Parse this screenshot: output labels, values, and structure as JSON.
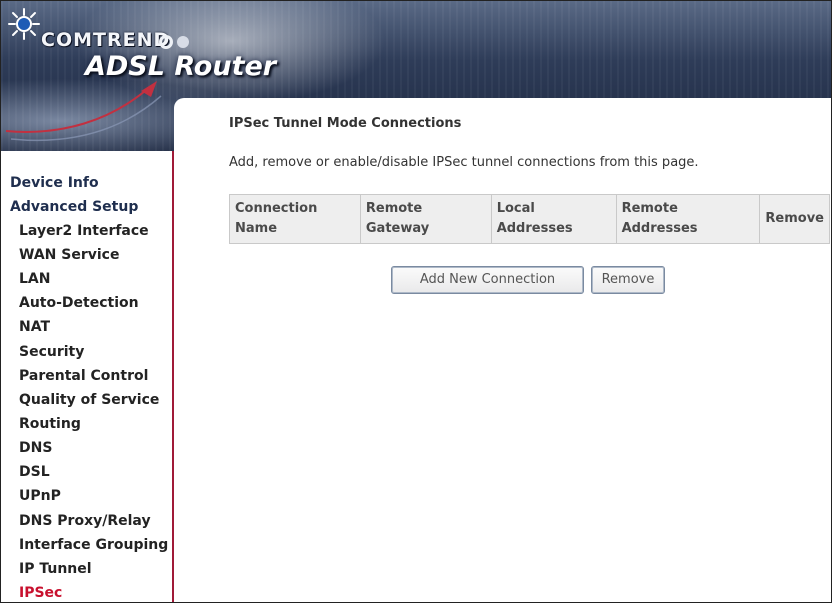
{
  "header": {
    "brand": "COMTREND",
    "product": "ADSL Router"
  },
  "sidebar": {
    "items": [
      {
        "label": "Device Info",
        "level": 0,
        "active": false
      },
      {
        "label": "Advanced Setup",
        "level": 0,
        "active": false
      },
      {
        "label": "Layer2 Interface",
        "level": 1,
        "active": false
      },
      {
        "label": "WAN Service",
        "level": 1,
        "active": false
      },
      {
        "label": "LAN",
        "level": 1,
        "active": false
      },
      {
        "label": "Auto-Detection",
        "level": 1,
        "active": false
      },
      {
        "label": "NAT",
        "level": 1,
        "active": false
      },
      {
        "label": "Security",
        "level": 1,
        "active": false
      },
      {
        "label": "Parental Control",
        "level": 1,
        "active": false
      },
      {
        "label": "Quality of Service",
        "level": 1,
        "active": false
      },
      {
        "label": "Routing",
        "level": 1,
        "active": false
      },
      {
        "label": "DNS",
        "level": 1,
        "active": false
      },
      {
        "label": "DSL",
        "level": 1,
        "active": false
      },
      {
        "label": "UPnP",
        "level": 1,
        "active": false
      },
      {
        "label": "DNS Proxy/Relay",
        "level": 1,
        "active": false
      },
      {
        "label": "Interface Grouping",
        "level": 1,
        "active": false
      },
      {
        "label": "IP Tunnel",
        "level": 1,
        "active": false
      },
      {
        "label": "IPSec",
        "level": 1,
        "active": true
      }
    ]
  },
  "main": {
    "title": "IPSec Tunnel Mode Connections",
    "description": "Add, remove or enable/disable IPSec tunnel connections from this page.",
    "table": {
      "headers": [
        {
          "line1": "Connection",
          "line2": "Name"
        },
        {
          "line1": "Remote",
          "line2": "Gateway"
        },
        {
          "line1": "Local",
          "line2": "Addresses"
        },
        {
          "line1": "Remote",
          "line2": "Addresses"
        },
        {
          "line1": "Remove",
          "line2": ""
        }
      ],
      "rows": []
    },
    "buttons": {
      "add_label": "Add New Connection",
      "remove_label": "Remove"
    }
  },
  "colors": {
    "active_nav": "#c8102e",
    "sidebar_border": "#a01a38",
    "table_header_bg": "#eeeeee"
  }
}
